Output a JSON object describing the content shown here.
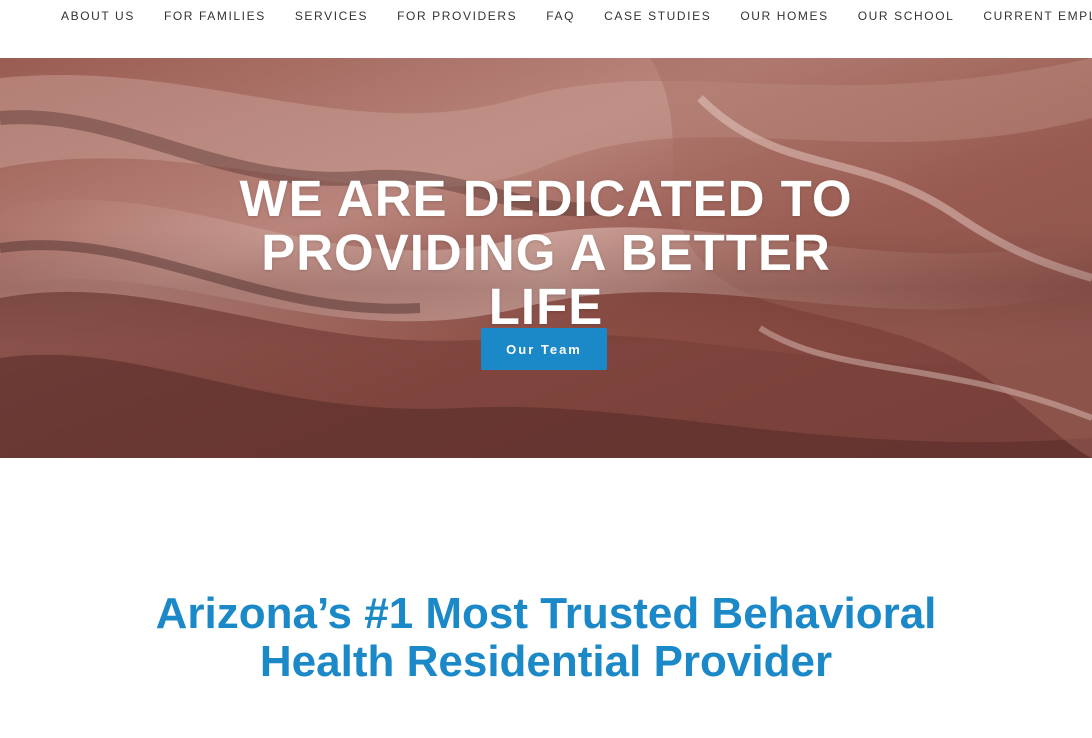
{
  "nav": {
    "items": [
      {
        "label": "ABOUT US"
      },
      {
        "label": "FOR FAMILIES"
      },
      {
        "label": "SERVICES"
      },
      {
        "label": "FOR PROVIDERS"
      },
      {
        "label": "FAQ"
      },
      {
        "label": "CASE STUDIES"
      },
      {
        "label": "OUR HOMES"
      },
      {
        "label": "OUR SCHOOL"
      },
      {
        "label": "CURRENT EMPLOYEES"
      }
    ]
  },
  "hero": {
    "title_lines": [
      "WE ARE DEDICATED TO",
      "PROVIDING A BETTER",
      "LIFE"
    ],
    "button_label": "Our Team",
    "background_description_color": "#8a5048"
  },
  "headline": {
    "lines": [
      "Arizona’s #1 Most Trusted Behavioral",
      "Health Residential Provider"
    ]
  },
  "colors": {
    "accent": "#1b88c8",
    "nav_text": "#333333",
    "hero_text": "#ffffff"
  }
}
